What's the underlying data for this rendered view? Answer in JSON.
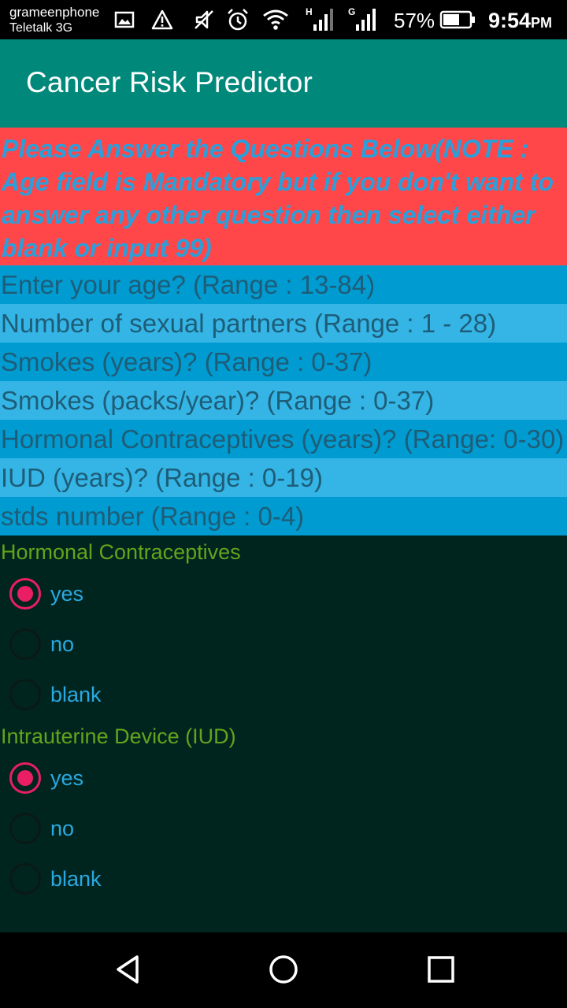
{
  "status_bar": {
    "carrier_primary": "grameenphone",
    "carrier_secondary": "Teletalk 3G",
    "signal1_label": "H",
    "signal2_label": "G",
    "battery_percent": "57%",
    "time": "9:54",
    "time_suffix": "PM",
    "icons": [
      "image-icon",
      "warning-icon",
      "muted-icon",
      "alarm-icon",
      "wifi-icon",
      "signal-icon",
      "signal-icon",
      "battery-icon"
    ]
  },
  "app_bar": {
    "title": "Cancer Risk Predictor",
    "color": "#00897b"
  },
  "note": {
    "text": "Please Answer the Questions Below(NOTE : Age field is Mandatory but if you don't want to answer any other question then select either blank or input 99)",
    "background": "#ff4649",
    "text_color": "#29a0db"
  },
  "fields": [
    {
      "placeholder": "Enter your age? (Range : 13-84)"
    },
    {
      "placeholder": "Number of sexual partners (Range : 1 - 28)"
    },
    {
      "placeholder": "Smokes (years)? (Range : 0-37)"
    },
    {
      "placeholder": "Smokes (packs/year)? (Range : 0-37)"
    },
    {
      "placeholder": "Hormonal Contraceptives (years)? (Range: 0-30)"
    },
    {
      "placeholder": "IUD (years)? (Range : 0-19)"
    },
    {
      "placeholder": "stds number (Range : 0-4)"
    }
  ],
  "groups": [
    {
      "label": "Hormonal Contraceptives",
      "options": [
        {
          "label": "yes",
          "checked": true
        },
        {
          "label": "no",
          "checked": false
        },
        {
          "label": "blank",
          "checked": false
        }
      ]
    },
    {
      "label": "Intrauterine Device (IUD)",
      "options": [
        {
          "label": "yes",
          "checked": true
        },
        {
          "label": "no",
          "checked": false
        },
        {
          "label": "blank",
          "checked": false
        }
      ]
    }
  ],
  "nav_bar": {
    "buttons": [
      "back-icon",
      "home-icon",
      "recents-icon"
    ]
  },
  "colors": {
    "accent": "#e91e63",
    "content_background": "#00251f",
    "field_dark": "#009bd0",
    "field_light": "#34b5e6",
    "group_label": "#63a41c"
  }
}
